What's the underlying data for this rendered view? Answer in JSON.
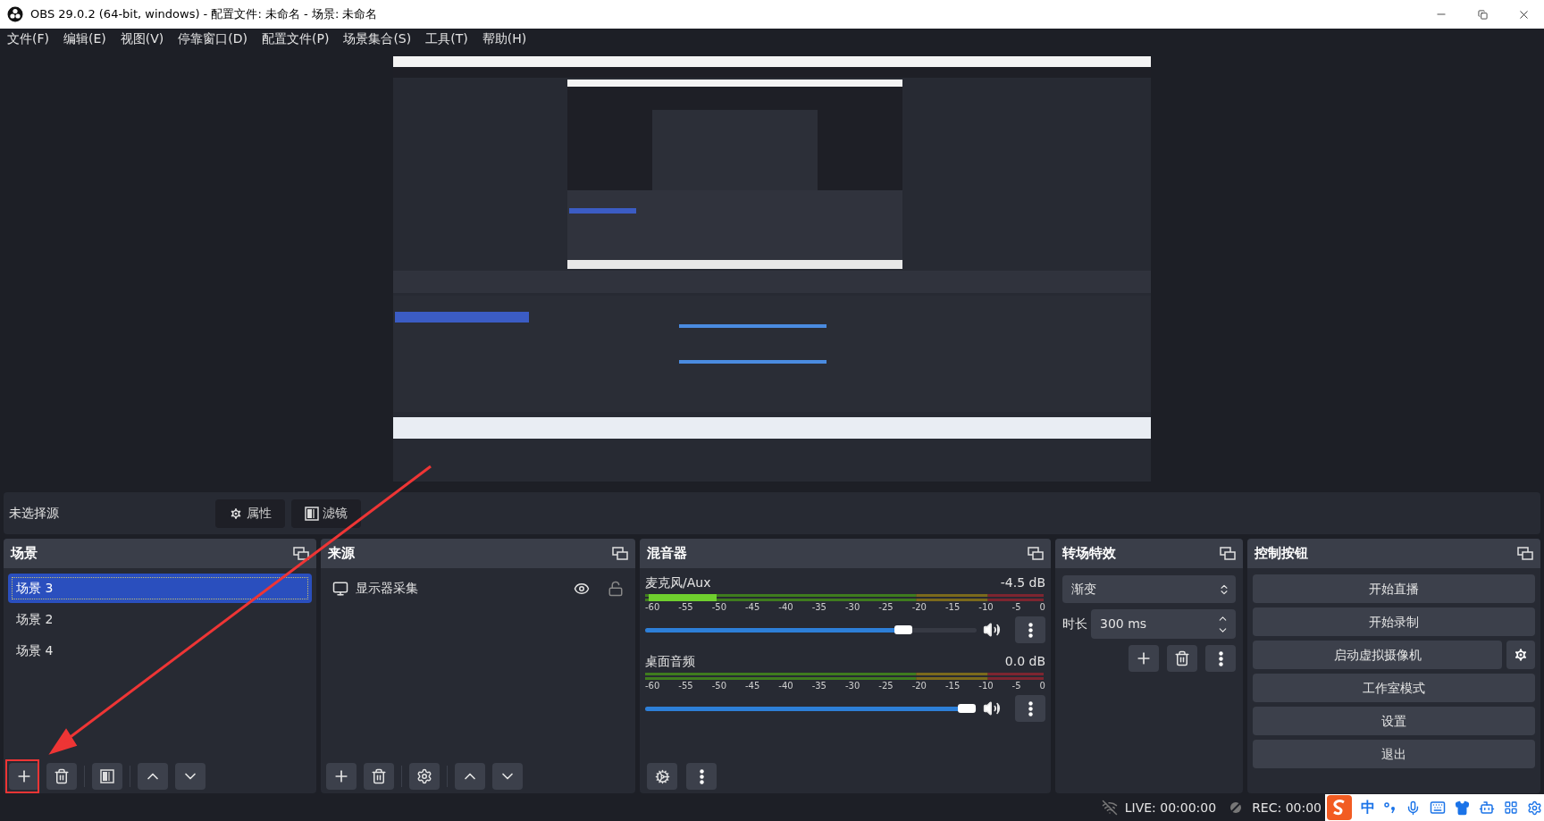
{
  "window": {
    "title": "OBS 29.0.2 (64-bit, windows) - 配置文件: 未命名 - 场景: 未命名"
  },
  "menu": [
    "文件(F)",
    "编辑(E)",
    "视图(V)",
    "停靠窗口(D)",
    "配置文件(P)",
    "场景集合(S)",
    "工具(T)",
    "帮助(H)"
  ],
  "context_bar": {
    "label": "未选择源",
    "buttons": [
      {
        "kind": "gear",
        "label": "属性"
      },
      {
        "kind": "filter",
        "label": "滤镜"
      }
    ]
  },
  "scenes": {
    "title": "场景",
    "items": [
      {
        "label": "场景 3",
        "selected": true
      },
      {
        "label": "场景 2",
        "selected": false
      },
      {
        "label": "场景 4",
        "selected": false
      }
    ]
  },
  "sources": {
    "title": "来源",
    "items": [
      {
        "label": "显示器采集",
        "visible": true,
        "locked": false
      }
    ]
  },
  "mixer": {
    "title": "混音器",
    "channels": [
      {
        "name": "麦克风/Aux",
        "reading": "-4.5 dB",
        "level": 0.78,
        "scale": [
          "-60",
          "-55",
          "-50",
          "-45",
          "-40",
          "-35",
          "-30",
          "-25",
          "-20",
          "-15",
          "-10",
          "-5",
          "0"
        ]
      },
      {
        "name": "桌面音频",
        "reading": "0.0 dB",
        "level": 0.97,
        "scale": [
          "-60",
          "-55",
          "-50",
          "-45",
          "-40",
          "-35",
          "-30",
          "-25",
          "-20",
          "-15",
          "-10",
          "-5",
          "0"
        ]
      }
    ]
  },
  "transitions": {
    "title": "转场特效",
    "transition": "渐变",
    "duration_label": "时长",
    "duration": "300 ms"
  },
  "controls": {
    "title": "控制按钮",
    "buttons": [
      {
        "label": "开始直播",
        "settings": false
      },
      {
        "label": "开始录制",
        "settings": false
      },
      {
        "label": "启动虚拟摄像机",
        "settings": true
      },
      {
        "label": "工作室模式",
        "settings": false
      },
      {
        "label": "设置",
        "settings": false
      },
      {
        "label": "退出",
        "settings": false
      }
    ]
  },
  "status_bar": {
    "live": "LIVE: 00:00:00",
    "rec": "REC: 00:00"
  },
  "ime": {
    "mode": "中"
  }
}
